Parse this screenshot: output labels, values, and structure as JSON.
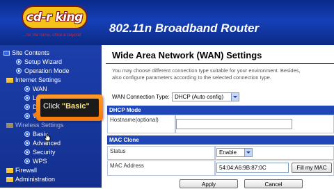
{
  "header": {
    "logo_text": "cd-r king",
    "tagline": "...for the home, office & beyond",
    "product_title": "802.11n Broadband Router"
  },
  "sidebar": {
    "items": [
      {
        "label": "Site Contents",
        "icon": "tree-icon"
      },
      {
        "label": "Setup Wizard",
        "icon": "arrow-icon"
      },
      {
        "label": "Operation Mode",
        "icon": "arrow-icon"
      },
      {
        "label": "Internet Settings",
        "icon": "folder-icon"
      },
      {
        "label": "WAN",
        "icon": "arrow-icon"
      },
      {
        "label": "L",
        "icon": "arrow-icon"
      },
      {
        "label": "D",
        "icon": "arrow-icon"
      },
      {
        "label": "V",
        "icon": "arrow-icon"
      },
      {
        "label": "Wireless Settings",
        "icon": "folder-icon"
      },
      {
        "label": "Basic",
        "icon": "arrow-icon"
      },
      {
        "label": "Advanced",
        "icon": "arrow-icon"
      },
      {
        "label": "Security",
        "icon": "arrow-icon"
      },
      {
        "label": "WPS",
        "icon": "arrow-icon"
      },
      {
        "label": "Firewall",
        "icon": "folder-icon"
      },
      {
        "label": "Administration",
        "icon": "folder-icon"
      }
    ]
  },
  "callout": {
    "prefix": "Click ",
    "highlight": "\"Basic\""
  },
  "main": {
    "title": "Wide Area Network (WAN) Settings",
    "desc_line1": "You may choose different connection type suitable for your environment. Besides,",
    "desc_line2": "also configure parameters according to the selected connection type.",
    "conn_type_label": "WAN Connection Type:",
    "conn_type_value": "DHCP (Auto config)",
    "dhcp_header": "DHCP Mode",
    "hostname_label": "Hostname(optional)",
    "hostname_label2": "(optional)",
    "hostname_value": "",
    "mac_clone_header": "MAC Clone",
    "status_label": "Status",
    "status_value": "Enable",
    "mac_label": "MAC Address",
    "mac_value": "54:04:A6:9B:87:0C",
    "fill_mac_button": "Fill my MAC",
    "apply_button": "Apply",
    "cancel_button": "Cancel"
  },
  "colors": {
    "header_blue": "#1640b8",
    "section_blue": "#1f47b8",
    "callout_orange": "#f47a10",
    "logo_yellow": "#f4c318"
  }
}
